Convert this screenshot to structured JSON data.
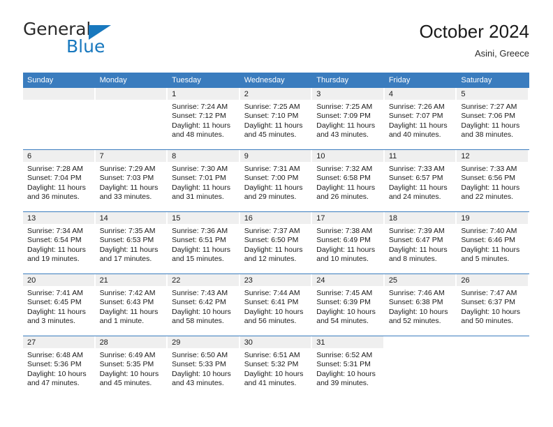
{
  "brand": {
    "name_top": "General",
    "name_bottom": "Blue",
    "triangle_color": "#1878be",
    "icon": "triangle-logo-icon"
  },
  "header": {
    "title": "October 2024",
    "subtitle": "Asini, Greece"
  },
  "theme": {
    "header_blue": "#3a7cbe",
    "daynum_band": "#efefef",
    "text": "#1a1a1a"
  },
  "weekday_headers": [
    "Sunday",
    "Monday",
    "Tuesday",
    "Wednesday",
    "Thursday",
    "Friday",
    "Saturday"
  ],
  "weeks": [
    [
      {
        "day": "",
        "sunrise": "",
        "sunset": "",
        "daylight_line1": "",
        "daylight_line2": "",
        "empty": true
      },
      {
        "day": "",
        "sunrise": "",
        "sunset": "",
        "daylight_line1": "",
        "daylight_line2": "",
        "empty": true
      },
      {
        "day": "1",
        "sunrise": "Sunrise: 7:24 AM",
        "sunset": "Sunset: 7:12 PM",
        "daylight_line1": "Daylight: 11 hours",
        "daylight_line2": "and 48 minutes."
      },
      {
        "day": "2",
        "sunrise": "Sunrise: 7:25 AM",
        "sunset": "Sunset: 7:10 PM",
        "daylight_line1": "Daylight: 11 hours",
        "daylight_line2": "and 45 minutes."
      },
      {
        "day": "3",
        "sunrise": "Sunrise: 7:25 AM",
        "sunset": "Sunset: 7:09 PM",
        "daylight_line1": "Daylight: 11 hours",
        "daylight_line2": "and 43 minutes."
      },
      {
        "day": "4",
        "sunrise": "Sunrise: 7:26 AM",
        "sunset": "Sunset: 7:07 PM",
        "daylight_line1": "Daylight: 11 hours",
        "daylight_line2": "and 40 minutes."
      },
      {
        "day": "5",
        "sunrise": "Sunrise: 7:27 AM",
        "sunset": "Sunset: 7:06 PM",
        "daylight_line1": "Daylight: 11 hours",
        "daylight_line2": "and 38 minutes."
      }
    ],
    [
      {
        "day": "6",
        "sunrise": "Sunrise: 7:28 AM",
        "sunset": "Sunset: 7:04 PM",
        "daylight_line1": "Daylight: 11 hours",
        "daylight_line2": "and 36 minutes."
      },
      {
        "day": "7",
        "sunrise": "Sunrise: 7:29 AM",
        "sunset": "Sunset: 7:03 PM",
        "daylight_line1": "Daylight: 11 hours",
        "daylight_line2": "and 33 minutes."
      },
      {
        "day": "8",
        "sunrise": "Sunrise: 7:30 AM",
        "sunset": "Sunset: 7:01 PM",
        "daylight_line1": "Daylight: 11 hours",
        "daylight_line2": "and 31 minutes."
      },
      {
        "day": "9",
        "sunrise": "Sunrise: 7:31 AM",
        "sunset": "Sunset: 7:00 PM",
        "daylight_line1": "Daylight: 11 hours",
        "daylight_line2": "and 29 minutes."
      },
      {
        "day": "10",
        "sunrise": "Sunrise: 7:32 AM",
        "sunset": "Sunset: 6:58 PM",
        "daylight_line1": "Daylight: 11 hours",
        "daylight_line2": "and 26 minutes."
      },
      {
        "day": "11",
        "sunrise": "Sunrise: 7:33 AM",
        "sunset": "Sunset: 6:57 PM",
        "daylight_line1": "Daylight: 11 hours",
        "daylight_line2": "and 24 minutes."
      },
      {
        "day": "12",
        "sunrise": "Sunrise: 7:33 AM",
        "sunset": "Sunset: 6:56 PM",
        "daylight_line1": "Daylight: 11 hours",
        "daylight_line2": "and 22 minutes."
      }
    ],
    [
      {
        "day": "13",
        "sunrise": "Sunrise: 7:34 AM",
        "sunset": "Sunset: 6:54 PM",
        "daylight_line1": "Daylight: 11 hours",
        "daylight_line2": "and 19 minutes."
      },
      {
        "day": "14",
        "sunrise": "Sunrise: 7:35 AM",
        "sunset": "Sunset: 6:53 PM",
        "daylight_line1": "Daylight: 11 hours",
        "daylight_line2": "and 17 minutes."
      },
      {
        "day": "15",
        "sunrise": "Sunrise: 7:36 AM",
        "sunset": "Sunset: 6:51 PM",
        "daylight_line1": "Daylight: 11 hours",
        "daylight_line2": "and 15 minutes."
      },
      {
        "day": "16",
        "sunrise": "Sunrise: 7:37 AM",
        "sunset": "Sunset: 6:50 PM",
        "daylight_line1": "Daylight: 11 hours",
        "daylight_line2": "and 12 minutes."
      },
      {
        "day": "17",
        "sunrise": "Sunrise: 7:38 AM",
        "sunset": "Sunset: 6:49 PM",
        "daylight_line1": "Daylight: 11 hours",
        "daylight_line2": "and 10 minutes."
      },
      {
        "day": "18",
        "sunrise": "Sunrise: 7:39 AM",
        "sunset": "Sunset: 6:47 PM",
        "daylight_line1": "Daylight: 11 hours",
        "daylight_line2": "and 8 minutes."
      },
      {
        "day": "19",
        "sunrise": "Sunrise: 7:40 AM",
        "sunset": "Sunset: 6:46 PM",
        "daylight_line1": "Daylight: 11 hours",
        "daylight_line2": "and 5 minutes."
      }
    ],
    [
      {
        "day": "20",
        "sunrise": "Sunrise: 7:41 AM",
        "sunset": "Sunset: 6:45 PM",
        "daylight_line1": "Daylight: 11 hours",
        "daylight_line2": "and 3 minutes."
      },
      {
        "day": "21",
        "sunrise": "Sunrise: 7:42 AM",
        "sunset": "Sunset: 6:43 PM",
        "daylight_line1": "Daylight: 11 hours",
        "daylight_line2": "and 1 minute."
      },
      {
        "day": "22",
        "sunrise": "Sunrise: 7:43 AM",
        "sunset": "Sunset: 6:42 PM",
        "daylight_line1": "Daylight: 10 hours",
        "daylight_line2": "and 58 minutes."
      },
      {
        "day": "23",
        "sunrise": "Sunrise: 7:44 AM",
        "sunset": "Sunset: 6:41 PM",
        "daylight_line1": "Daylight: 10 hours",
        "daylight_line2": "and 56 minutes."
      },
      {
        "day": "24",
        "sunrise": "Sunrise: 7:45 AM",
        "sunset": "Sunset: 6:39 PM",
        "daylight_line1": "Daylight: 10 hours",
        "daylight_line2": "and 54 minutes."
      },
      {
        "day": "25",
        "sunrise": "Sunrise: 7:46 AM",
        "sunset": "Sunset: 6:38 PM",
        "daylight_line1": "Daylight: 10 hours",
        "daylight_line2": "and 52 minutes."
      },
      {
        "day": "26",
        "sunrise": "Sunrise: 7:47 AM",
        "sunset": "Sunset: 6:37 PM",
        "daylight_line1": "Daylight: 10 hours",
        "daylight_line2": "and 50 minutes."
      }
    ],
    [
      {
        "day": "27",
        "sunrise": "Sunrise: 6:48 AM",
        "sunset": "Sunset: 5:36 PM",
        "daylight_line1": "Daylight: 10 hours",
        "daylight_line2": "and 47 minutes."
      },
      {
        "day": "28",
        "sunrise": "Sunrise: 6:49 AM",
        "sunset": "Sunset: 5:35 PM",
        "daylight_line1": "Daylight: 10 hours",
        "daylight_line2": "and 45 minutes."
      },
      {
        "day": "29",
        "sunrise": "Sunrise: 6:50 AM",
        "sunset": "Sunset: 5:33 PM",
        "daylight_line1": "Daylight: 10 hours",
        "daylight_line2": "and 43 minutes."
      },
      {
        "day": "30",
        "sunrise": "Sunrise: 6:51 AM",
        "sunset": "Sunset: 5:32 PM",
        "daylight_line1": "Daylight: 10 hours",
        "daylight_line2": "and 41 minutes."
      },
      {
        "day": "31",
        "sunrise": "Sunrise: 6:52 AM",
        "sunset": "Sunset: 5:31 PM",
        "daylight_line1": "Daylight: 10 hours",
        "daylight_line2": "and 39 minutes."
      },
      {
        "day": "",
        "sunrise": "",
        "sunset": "",
        "daylight_line1": "",
        "daylight_line2": "",
        "empty": true,
        "blank": true
      },
      {
        "day": "",
        "sunrise": "",
        "sunset": "",
        "daylight_line1": "",
        "daylight_line2": "",
        "empty": true,
        "blank": true
      }
    ]
  ]
}
